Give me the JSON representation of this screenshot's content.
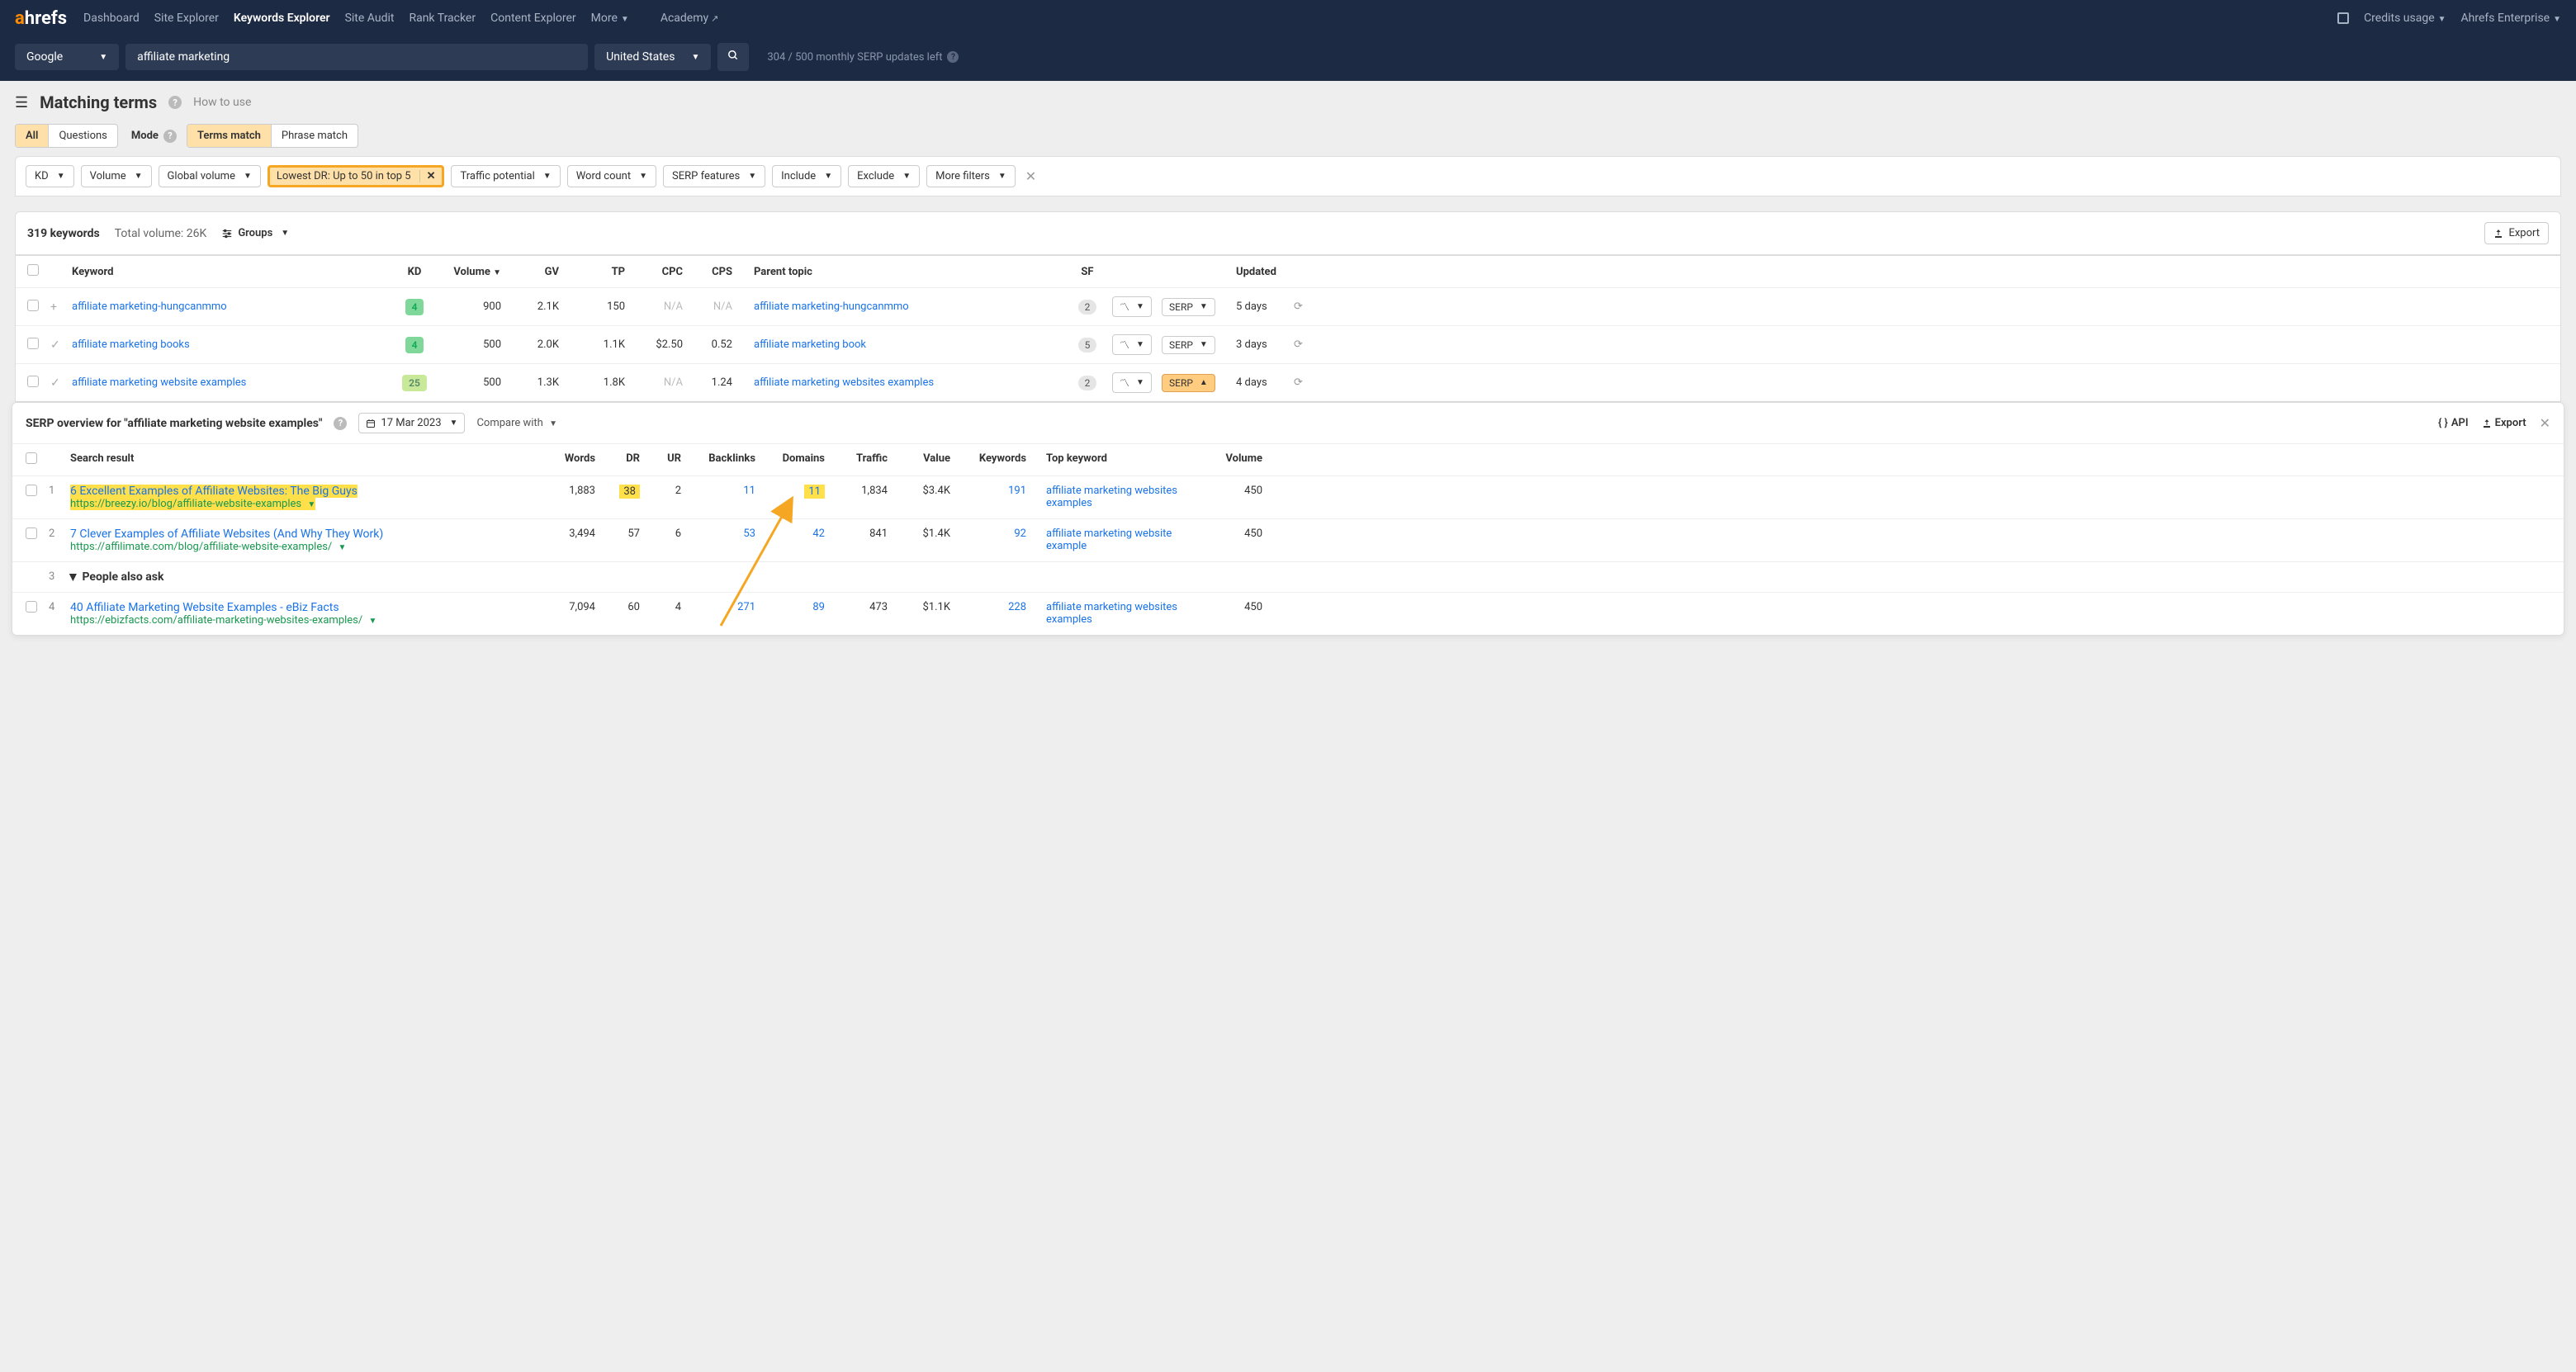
{
  "topbar": {
    "logo": {
      "a": "a",
      "rest": "hrefs"
    },
    "nav": [
      "Dashboard",
      "Site Explorer",
      "Keywords Explorer",
      "Site Audit",
      "Rank Tracker",
      "Content Explorer",
      "More"
    ],
    "activeNav": "Keywords Explorer",
    "academy": "Academy",
    "credits": "Credits usage",
    "account": "Ahrefs Enterprise"
  },
  "searchbar": {
    "engine": "Google",
    "query": "affiliate marketing",
    "country": "United States",
    "status": "304 / 500 monthly SERP updates left"
  },
  "page": {
    "title": "Matching terms",
    "howto": "How to use"
  },
  "tabs": {
    "scope": [
      "All",
      "Questions"
    ],
    "scopeActive": "All",
    "modeLabel": "Mode",
    "mode": [
      "Terms match",
      "Phrase match"
    ],
    "modeActive": "Terms match"
  },
  "filters": {
    "chips": [
      "KD",
      "Volume",
      "Global volume",
      "Traffic potential",
      "Word count",
      "SERP features",
      "Include",
      "Exclude",
      "More filters"
    ],
    "active": {
      "label": "Lowest DR: Up to 50 in top 5"
    }
  },
  "results": {
    "count": "319 keywords",
    "totalVol": "Total volume: 26K",
    "groups": "Groups",
    "export": "Export"
  },
  "ktable": {
    "headers": {
      "kw": "Keyword",
      "kd": "KD",
      "vol": "Volume",
      "gv": "GV",
      "tp": "TP",
      "cpc": "CPC",
      "cps": "CPS",
      "pt": "Parent topic",
      "sf": "SF",
      "upd": "Updated"
    },
    "rows": [
      {
        "exp": "+",
        "kw": "affiliate marketing-hungcanmmo",
        "kd": "4",
        "kdClass": "kd-green",
        "vol": "900",
        "gv": "2.1K",
        "tp": "150",
        "cpc": "N/A",
        "cps": "N/A",
        "pt": "affiliate marketing-hungcanmmo",
        "sf": "2",
        "serpActive": false,
        "upd": "5 days"
      },
      {
        "exp": "✓",
        "kw": "affiliate marketing books",
        "kd": "4",
        "kdClass": "kd-green",
        "vol": "500",
        "gv": "2.0K",
        "tp": "1.1K",
        "cpc": "$2.50",
        "cps": "0.52",
        "pt": "affiliate marketing book",
        "sf": "5",
        "serpActive": false,
        "upd": "3 days"
      },
      {
        "exp": "✓",
        "kw": "affiliate marketing website examples",
        "kd": "25",
        "kdClass": "kd-yellow",
        "vol": "500",
        "gv": "1.3K",
        "tp": "1.8K",
        "cpc": "N/A",
        "cps": "1.24",
        "pt": "affiliate marketing websites examples",
        "sf": "2",
        "serpActive": true,
        "upd": "4 days"
      }
    ],
    "serpLabel": "SERP"
  },
  "serp": {
    "title": "SERP overview for \"affiliate marketing website examples\"",
    "date": "17 Mar 2023",
    "compare": "Compare with",
    "api": "API",
    "export": "Export",
    "headers": {
      "sr": "Search result",
      "words": "Words",
      "dr": "DR",
      "ur": "UR",
      "bl": "Backlinks",
      "dom": "Domains",
      "tr": "Traffic",
      "val": "Value",
      "kw": "Keywords",
      "top": "Top keyword",
      "vol": "Volume"
    },
    "rows": [
      {
        "pos": "1",
        "title": "6 Excellent Examples of Affiliate Websites: The Big Guys",
        "url": "https://breezy.io/blog/affiliate-website-examples",
        "hl": true,
        "words": "1,883",
        "dr": "38",
        "drHl": true,
        "ur": "2",
        "bl": "11",
        "dom": "11",
        "domHl": true,
        "tr": "1,834",
        "val": "$3.4K",
        "kw": "191",
        "top": "affiliate marketing websites examples",
        "vol": "450"
      },
      {
        "pos": "2",
        "title": "7 Clever Examples of Affiliate Websites (And Why They Work)",
        "url": "https://affilimate.com/blog/affiliate-website-examples/",
        "hl": false,
        "words": "3,494",
        "dr": "57",
        "ur": "6",
        "bl": "53",
        "dom": "42",
        "tr": "841",
        "val": "$1.4K",
        "kw": "92",
        "top": "affiliate marketing website example",
        "vol": "450"
      },
      {
        "pos": "3",
        "paa": "People also ask"
      },
      {
        "pos": "4",
        "title": "40 Affiliate Marketing Website Examples - eBiz Facts",
        "url": "https://ebizfacts.com/affiliate-marketing-websites-examples/",
        "hl": false,
        "words": "7,094",
        "dr": "60",
        "ur": "4",
        "bl": "271",
        "dom": "89",
        "tr": "473",
        "val": "$1.1K",
        "kw": "228",
        "top": "affiliate marketing websites examples",
        "vol": "450"
      }
    ]
  }
}
